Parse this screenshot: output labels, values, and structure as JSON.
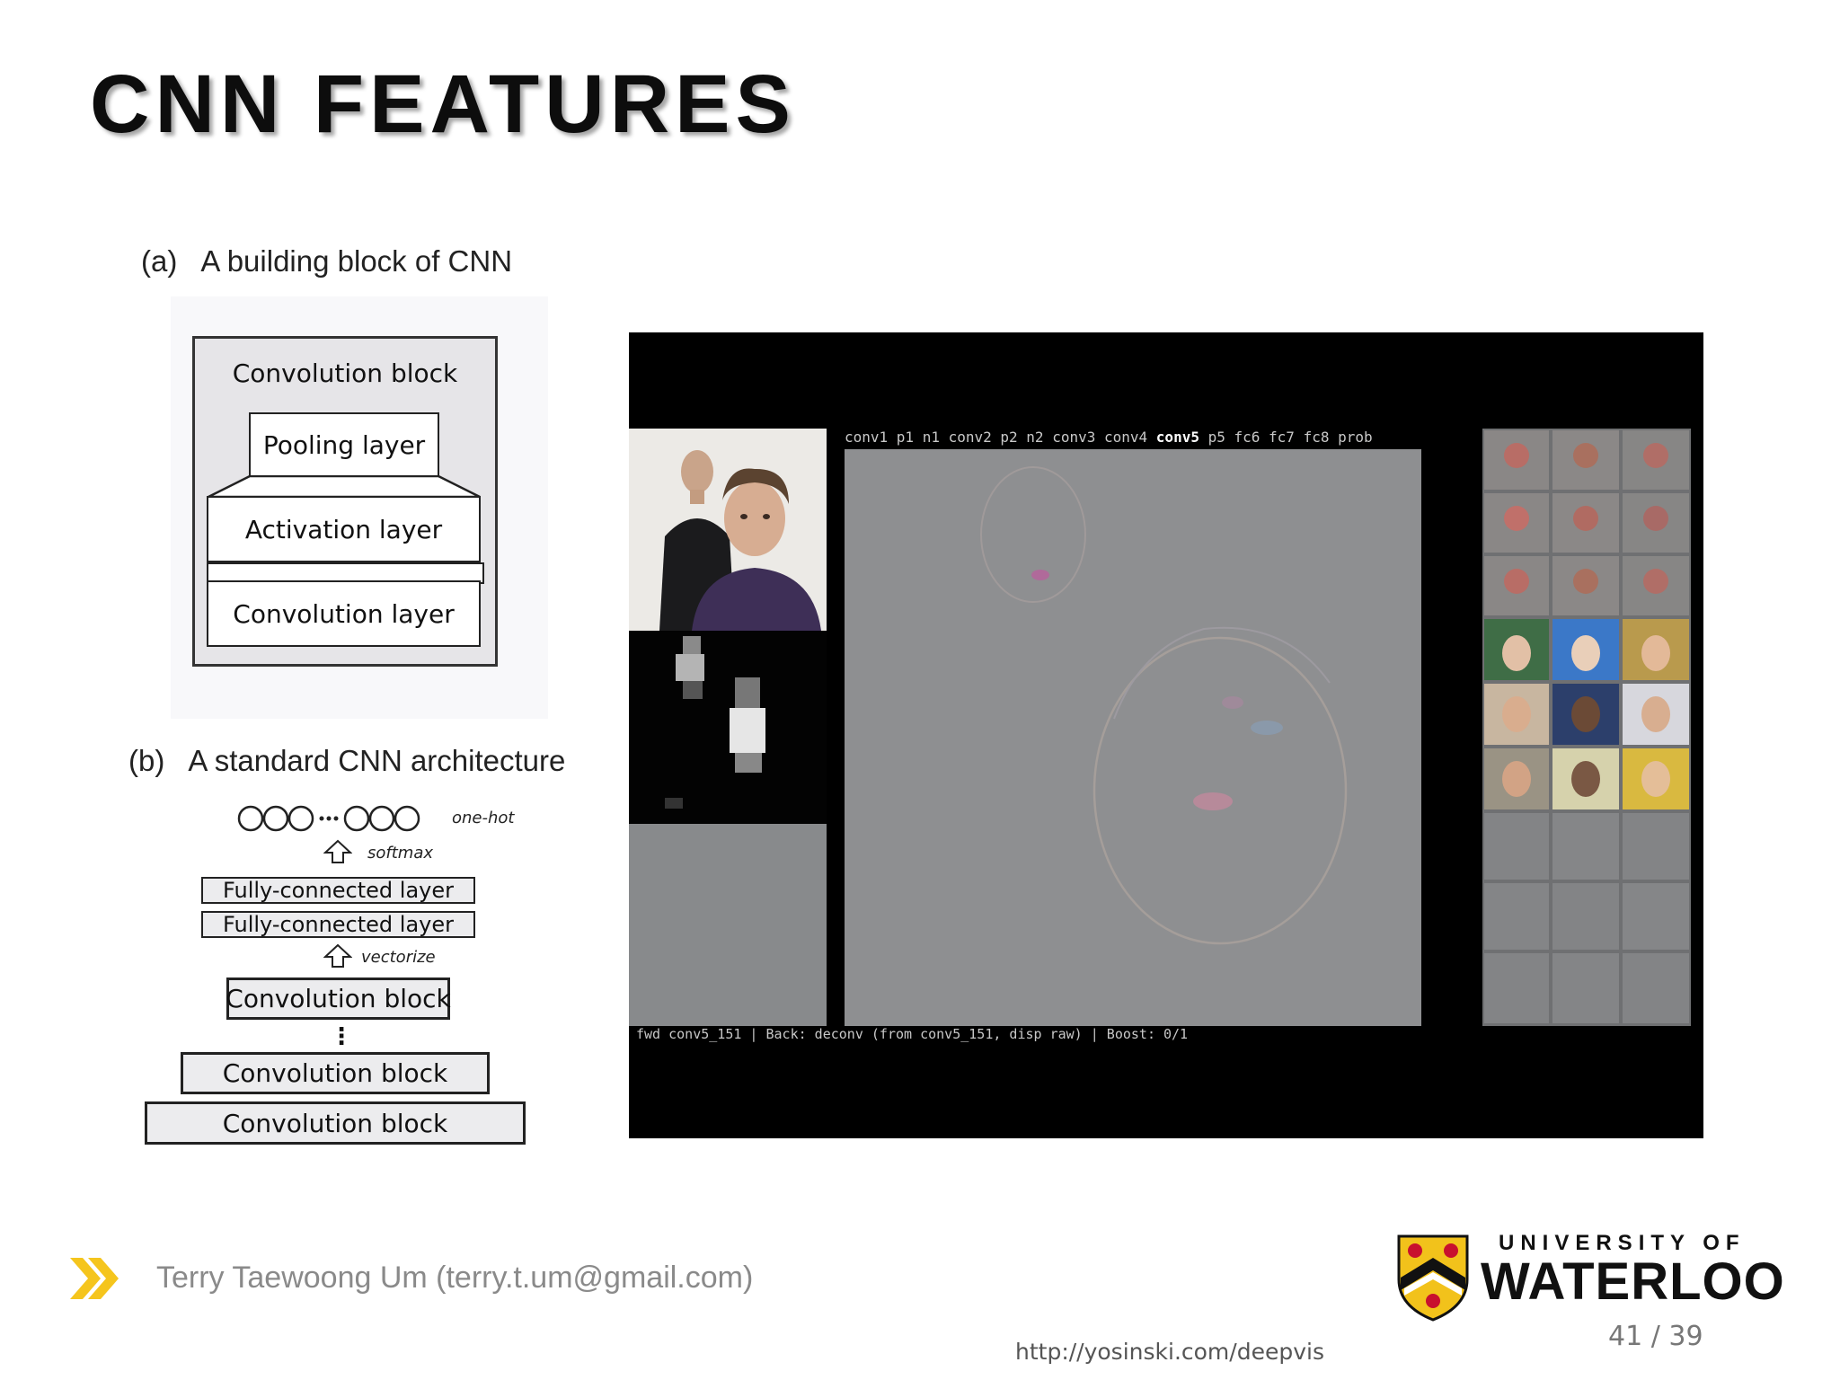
{
  "slide": {
    "title": "CNN FEATURES",
    "footer_author": "Terry Taewoong Um (terry.t.um@gmail.com)",
    "source_url": "http://yosinski.com/deepvis",
    "page_number": "41 / 39",
    "logo_top": "UNIVERSITY OF",
    "logo_main": "WATERLOO",
    "footer_arrow_icon": "double-chevron-right-icon",
    "accent_color": "#f5c51d"
  },
  "panel_a": {
    "label": "(a)",
    "caption": "A building block of CNN",
    "outer_block": "Convolution block",
    "pooling": "Pooling layer",
    "activation": "Activation layer",
    "convolution": "Convolution layer"
  },
  "panel_b": {
    "label": "(b)",
    "caption": "A standard CNN architecture",
    "onehot": "one-hot",
    "softmax": "softmax",
    "vectorize": "vectorize",
    "fc1": "Fully-connected layer",
    "fc2": "Fully-connected layer",
    "conv_top": "Convolution block",
    "ellipsis": "⋮",
    "conv_mid": "Convolution block",
    "conv_bottom": "Convolution block"
  },
  "video": {
    "layers_before": "conv1 p1 n1 conv2 p2 n2 conv3 conv4",
    "layer_active": "conv5",
    "layers_after": "p5 fc6 fc7 fc8 prob",
    "status": "fwd conv5_151 | Back: deconv (from conv5_151, disp raw) | Boost: 0/1"
  }
}
